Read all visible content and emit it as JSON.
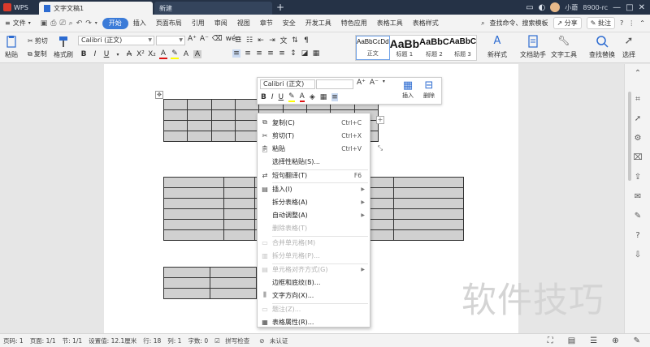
{
  "titlebar": {
    "app_name": "WPS",
    "doc_tab": "文字文稿1",
    "new_tab": "新建",
    "plus": "+",
    "user_name": "小蘑",
    "user_id": "8900-rc"
  },
  "menubar": {
    "file": "文件",
    "items": [
      "开始",
      "插入",
      "页面布局",
      "引用",
      "审阅",
      "视图",
      "章节",
      "安全",
      "开发工具",
      "特色应用",
      "表格工具",
      "表格样式"
    ],
    "active_index": 0,
    "search": "查找命令、搜索模板",
    "share": "分享",
    "comment": "批注"
  },
  "ribbon": {
    "paste": "粘贴",
    "cut": "剪切",
    "copy": "复制",
    "format_painter": "格式刷",
    "font_name": "Calibri (正文)",
    "font_size": "",
    "styles": [
      {
        "sample": "AaBbCcDd",
        "label": "正文"
      },
      {
        "sample": "AaBb",
        "label": "标题 1"
      },
      {
        "sample": "AaBbC",
        "label": "标题 2"
      },
      {
        "sample": "AaBbC",
        "label": "标题 3"
      }
    ],
    "new_style": "新样式",
    "doc_assistant": "文档助手",
    "text_tools": "文字工具",
    "find_replace": "查找替换",
    "select": "选择"
  },
  "mini_toolbar": {
    "font_name": "Calibri (正文)",
    "insert": "插入",
    "delete": "删除"
  },
  "context_menu": {
    "items": [
      {
        "label": "复制(C)",
        "shortcut": "Ctrl+C",
        "icon": "copy-icon",
        "disabled": false
      },
      {
        "label": "剪切(T)",
        "shortcut": "Ctrl+X",
        "icon": "cut-icon",
        "disabled": false
      },
      {
        "label": "粘贴",
        "shortcut": "Ctrl+V",
        "icon": "paste-icon",
        "disabled": false
      },
      {
        "label": "选择性粘贴(S)...",
        "shortcut": "",
        "icon": "",
        "disabled": false
      },
      {
        "label": "短句翻译(T)",
        "shortcut": "F6",
        "icon": "translate-icon",
        "disabled": false
      },
      {
        "label": "插入(I)",
        "shortcut": "",
        "icon": "insert-icon",
        "disabled": false,
        "submenu": true
      },
      {
        "label": "拆分表格(A)",
        "shortcut": "",
        "icon": "",
        "disabled": false,
        "submenu": true
      },
      {
        "label": "自动调整(A)",
        "shortcut": "",
        "icon": "",
        "disabled": false,
        "submenu": true
      },
      {
        "label": "删除表格(T)",
        "shortcut": "",
        "icon": "",
        "disabled": true
      },
      {
        "label": "合并单元格(M)",
        "shortcut": "",
        "icon": "merge-cells-icon",
        "disabled": true
      },
      {
        "label": "拆分单元格(P)...",
        "shortcut": "",
        "icon": "split-cells-icon",
        "disabled": true
      },
      {
        "label": "单元格对齐方式(G)",
        "shortcut": "",
        "icon": "cell-align-icon",
        "disabled": true,
        "submenu": true
      },
      {
        "label": "边框和底纹(B)...",
        "shortcut": "",
        "icon": "",
        "disabled": false
      },
      {
        "label": "文字方向(X)...",
        "shortcut": "",
        "icon": "text-direction-icon",
        "disabled": false
      },
      {
        "label": "题注(Z)...",
        "shortcut": "",
        "icon": "caption-icon",
        "disabled": true
      },
      {
        "label": "表格属性(R)...",
        "shortcut": "",
        "icon": "table-properties-icon",
        "disabled": false
      }
    ]
  },
  "watermark": "软件技巧",
  "statusbar": {
    "page_num": "页码: 1",
    "pages": "页面: 1/1",
    "section": "节: 1/1",
    "position": "设置值: 12.1厘米",
    "row": "行: 18",
    "col": "列: 1",
    "word_count": "字数: 0",
    "spell_check": "拼写检查",
    "auth": "未认证"
  }
}
